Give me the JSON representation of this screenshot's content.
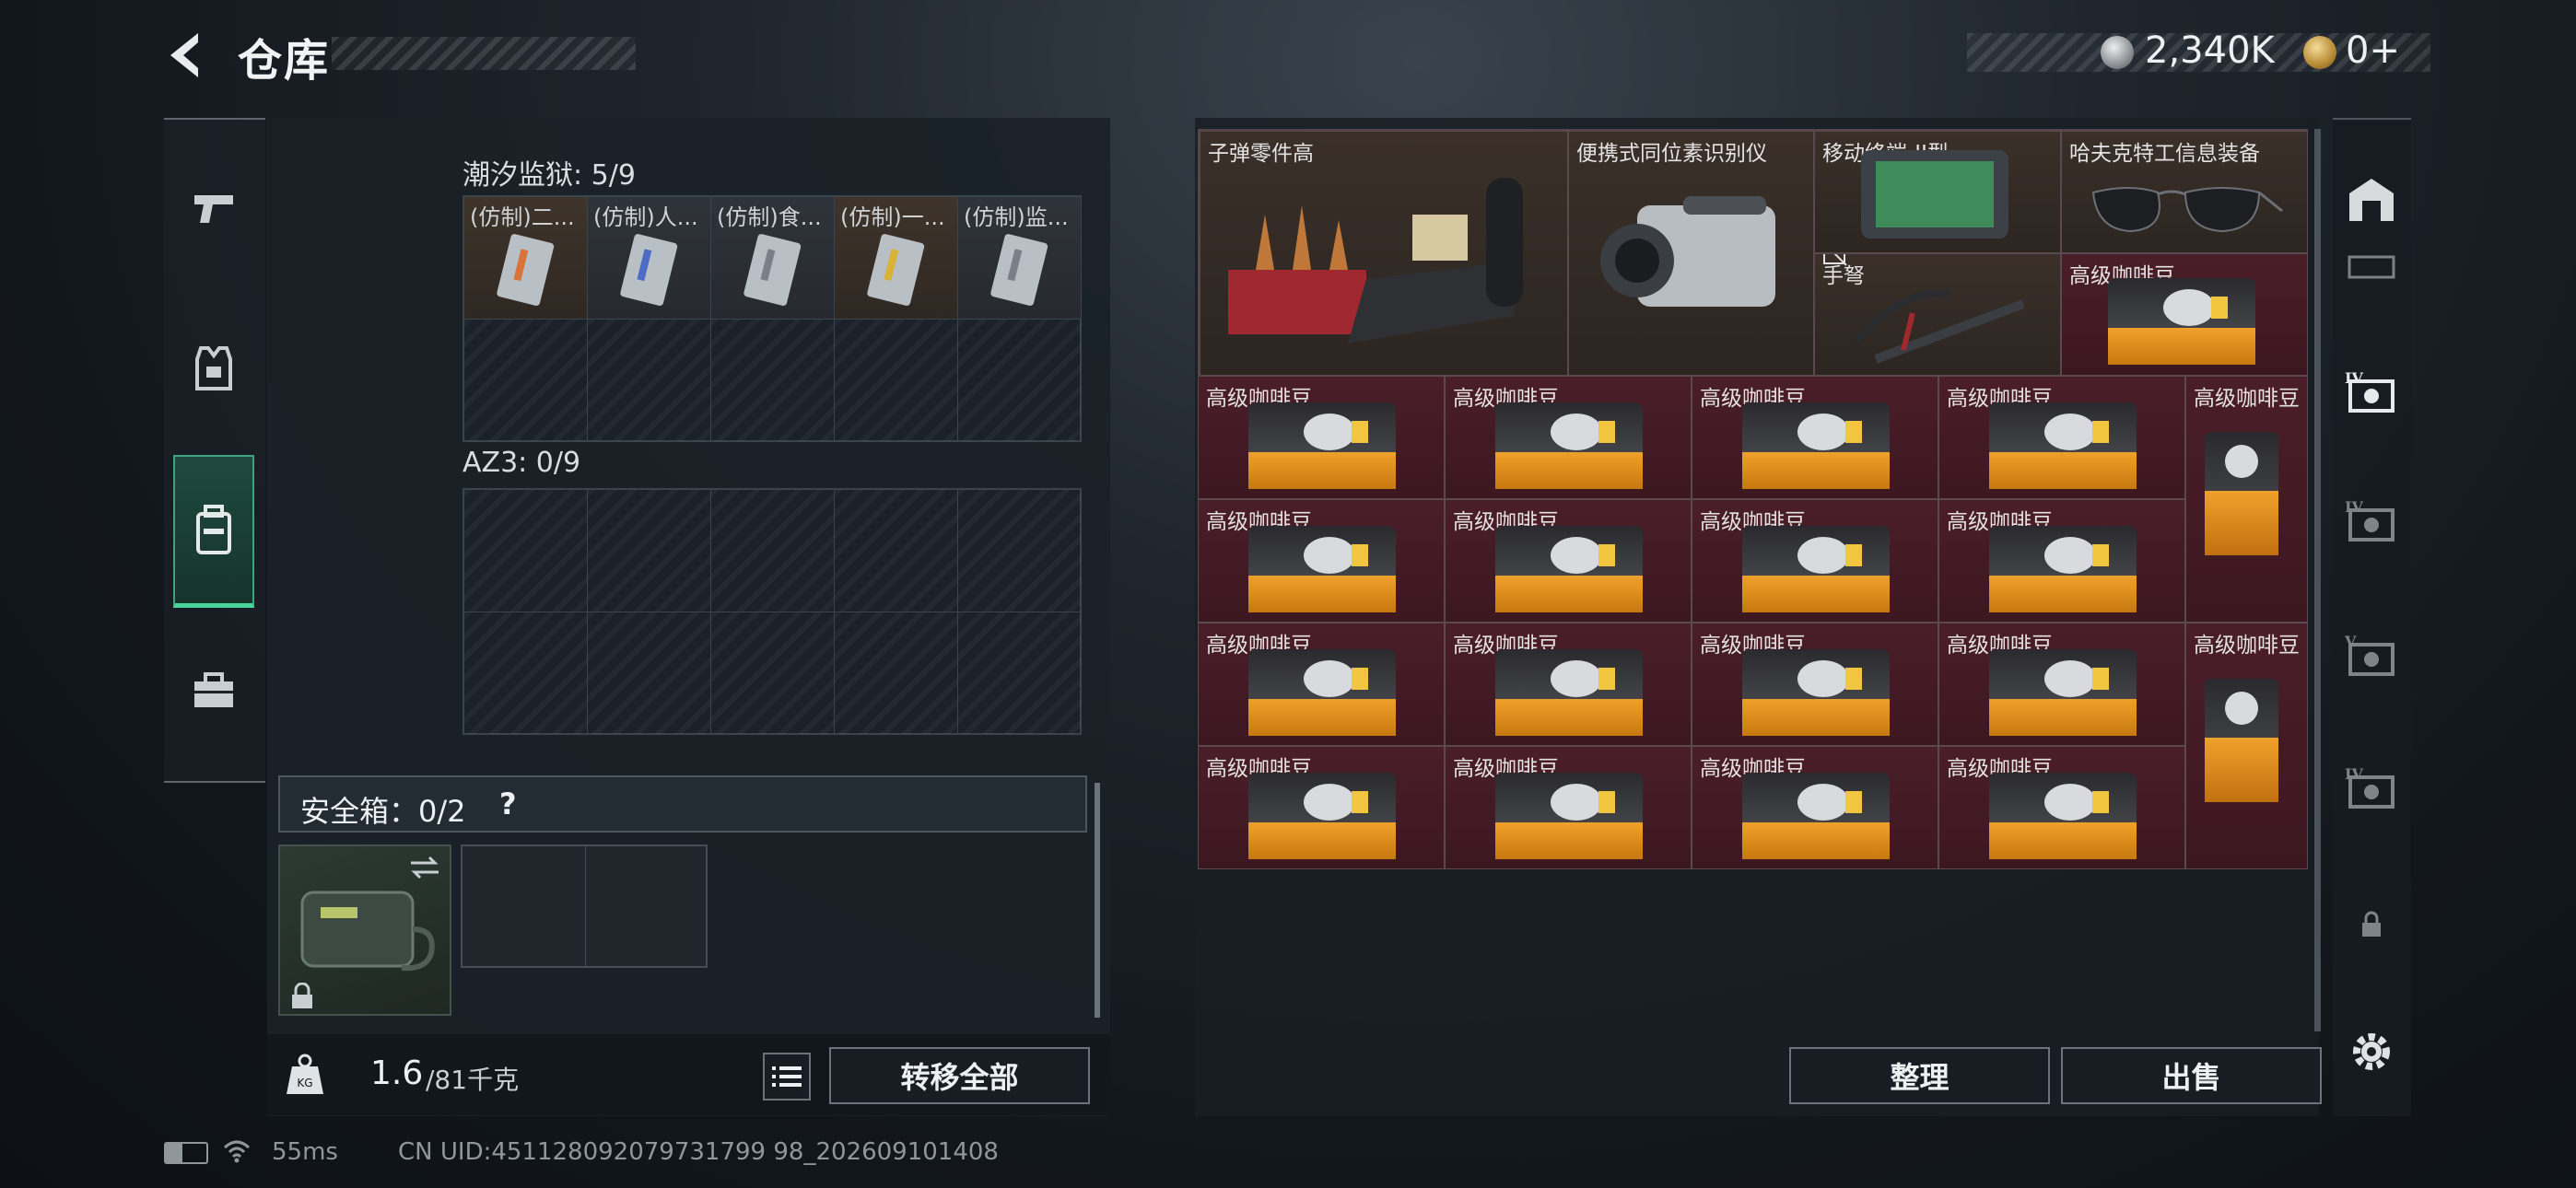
{
  "header": {
    "title": "仓库",
    "currency1": "2,340K",
    "currency2": "0+"
  },
  "left": {
    "section1": {
      "label": "潮汐监狱: 5/9",
      "items": [
        "(仿制)二...",
        "(仿制)人...",
        "(仿制)食...",
        "(仿制)一...",
        "(仿制)监..."
      ]
    },
    "section2": {
      "label": "AZ3: 0/9"
    },
    "safe": {
      "label": "安全箱：0/2",
      "help": "?"
    },
    "weight": {
      "current": "1.6",
      "max": "/81千克",
      "kg": "KG"
    },
    "transfer": "转移全部"
  },
  "right": {
    "items": {
      "bullet_parts": "子弹零件高",
      "isotope": "便携式同位素识别仪",
      "terminal": "移动终端-II型",
      "crossbow": "手弩",
      "glasses": "哈夫克特工信息装备",
      "coffee": "高级咖啡豆"
    },
    "tidy": "整理",
    "sell": "出售"
  },
  "status": {
    "ping": "55ms",
    "uid": "CN UID:451128092079731799 98_202609101408"
  },
  "colors": {
    "accent": "#49d49a",
    "item_red": "#4a1e28",
    "item_brown": "#3a3029"
  }
}
